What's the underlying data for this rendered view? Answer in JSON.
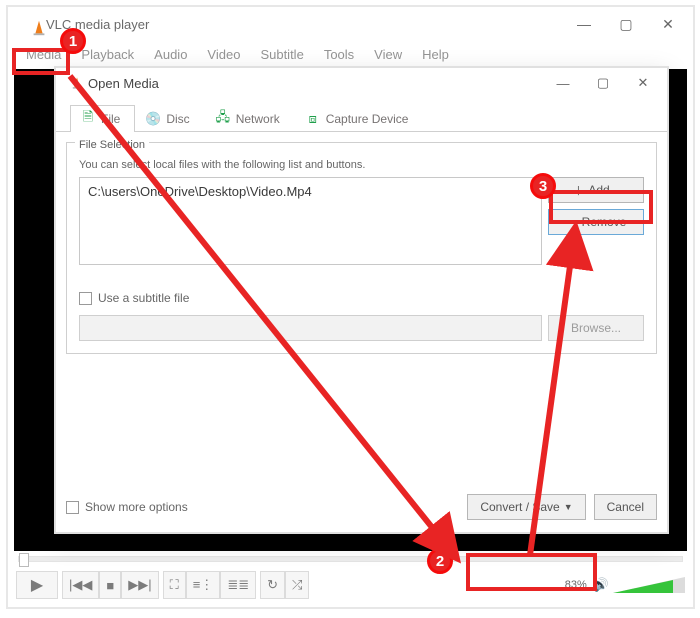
{
  "app": {
    "title": "VLC media player",
    "menus": [
      "Media",
      "Playback",
      "Audio",
      "Video",
      "Subtitle",
      "Tools",
      "View",
      "Help"
    ],
    "volume_pct": "83%"
  },
  "dialog": {
    "title": "Open Media",
    "tabs": {
      "file": "File",
      "disc": "Disc",
      "network": "Network",
      "capture": "Capture Device"
    },
    "file_section": {
      "legend": "File Selection",
      "hint": "You can select local files with the following list and buttons.",
      "path": "C:\\users\\OneDrive\\Desktop\\Video.Mp4",
      "add": "Add...",
      "remove": "Remove",
      "subtitle_cb": "Use a subtitle file",
      "browse": "Browse..."
    },
    "footer": {
      "more": "Show more options",
      "convert": "Convert / Save",
      "cancel": "Cancel"
    }
  },
  "annotations": {
    "b1": "1",
    "b2": "2",
    "b3": "3"
  }
}
